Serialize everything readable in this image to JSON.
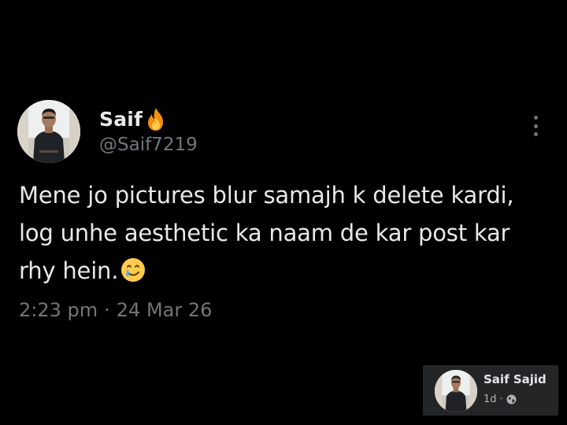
{
  "tweet": {
    "display_name": "Saif",
    "name_emoji_icon": "fire-icon",
    "handle": "@Saif7219",
    "text": "Mene jo pictures blur samajh k delete kardi, log unhe aesthetic ka naam de kar post kar rhy hein.",
    "text_emoji_icon": "smiling-face-with-tear-icon",
    "time": "2:23 pm",
    "separator": "·",
    "date": "24 Mar 26",
    "more_icon": "vertical-ellipsis-icon"
  },
  "facebook_card": {
    "name": "Saif Sajid",
    "age": "1d",
    "separator": "·",
    "privacy_icon": "globe-icon"
  },
  "colors": {
    "background": "#000000",
    "primary_text": "#e7e9ea",
    "secondary_text": "#71767b",
    "card_background": "#242526"
  }
}
